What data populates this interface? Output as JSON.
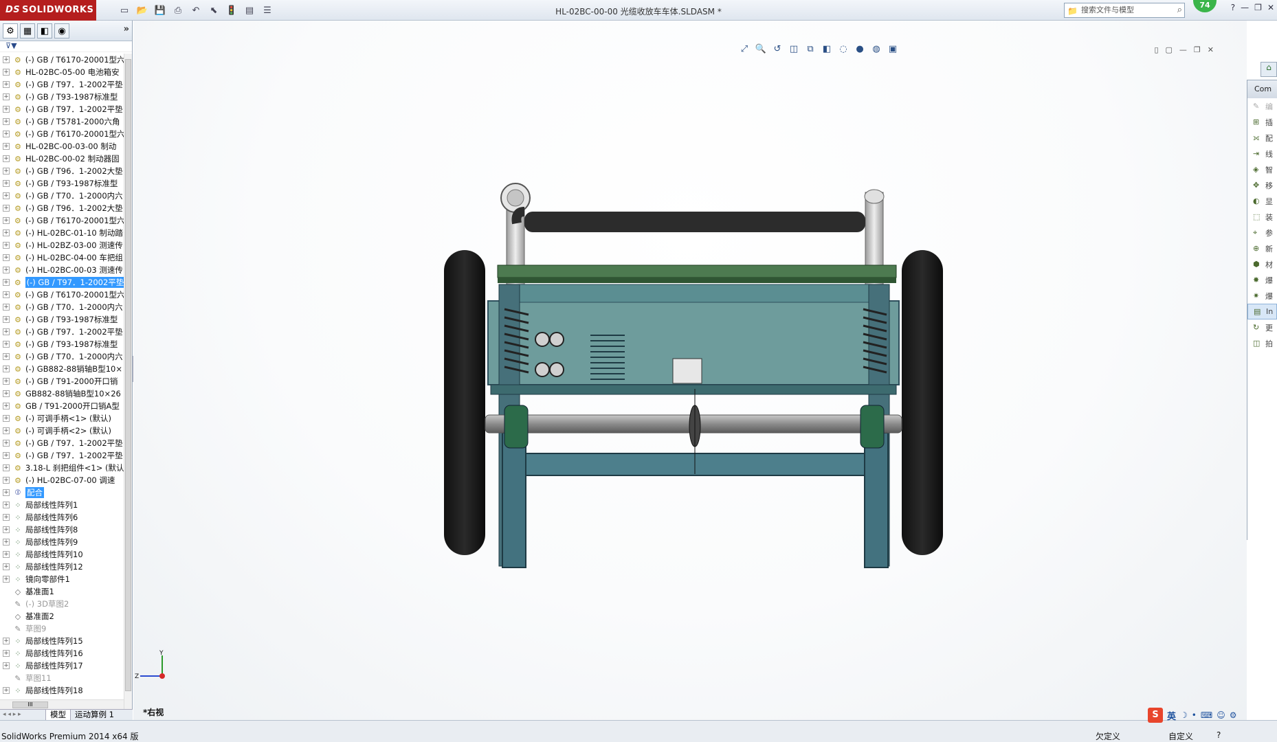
{
  "app": {
    "logo_text": "SOLIDWORKS",
    "logo_mark": "DS",
    "document_title": "HL-02BC-00-00 光缆收放车车体.SLDASM *",
    "search_placeholder": "搜索文件与模型",
    "notification_count": "74"
  },
  "toolbar_icons": [
    "new-icon",
    "open-icon",
    "save-icon",
    "print-icon",
    "undo-icon",
    "select-icon",
    "rebuild-icon",
    "file-props-icon",
    "options-icon"
  ],
  "left_panel": {
    "tabs": [
      "feature-manager",
      "property-manager",
      "config-manager",
      "display-manager"
    ],
    "expand_glyph": "»",
    "filter_glyph": "▼",
    "tree": [
      {
        "label": "(-) GB / T6170-20001型六",
        "icon": "part",
        "expand": true
      },
      {
        "label": "HL-02BC-05-00 电池箱安",
        "icon": "part",
        "expand": true
      },
      {
        "label": "(-) GB / T97．1-2002平垫",
        "icon": "part",
        "expand": true
      },
      {
        "label": "(-) GB / T93-1987标准型",
        "icon": "part",
        "expand": true
      },
      {
        "label": "(-) GB / T97．1-2002平垫",
        "icon": "part",
        "expand": true
      },
      {
        "label": "(-) GB / T5781-2000六角",
        "icon": "part",
        "expand": true
      },
      {
        "label": "(-) GB / T6170-20001型六",
        "icon": "part",
        "expand": true
      },
      {
        "label": "HL-02BC-00-03-00 制动",
        "icon": "part",
        "expand": true
      },
      {
        "label": "HL-02BC-00-02 制动器固",
        "icon": "part",
        "expand": true
      },
      {
        "label": "(-) GB / T96．1-2002大垫",
        "icon": "part",
        "expand": true
      },
      {
        "label": "(-) GB / T93-1987标准型",
        "icon": "part",
        "expand": true
      },
      {
        "label": "(-) GB / T70．1-2000内六",
        "icon": "part",
        "expand": true
      },
      {
        "label": "(-) GB / T96．1-2002大垫",
        "icon": "part",
        "expand": true
      },
      {
        "label": "(-) GB / T6170-20001型六",
        "icon": "part",
        "expand": true
      },
      {
        "label": "(-) HL-02BC-01-10 制动踏",
        "icon": "part",
        "expand": true
      },
      {
        "label": "(-) HL-02BZ-03-00 测速传",
        "icon": "part",
        "expand": true
      },
      {
        "label": "(-) HL-02BC-04-00 车把组",
        "icon": "part",
        "expand": true
      },
      {
        "label": "(-) HL-02BC-00-03 测速传",
        "icon": "part",
        "expand": true
      },
      {
        "label": "(-) GB / T97．1-2002平垫",
        "icon": "part",
        "expand": true,
        "selected": true
      },
      {
        "label": "(-) GB / T6170-20001型六",
        "icon": "part",
        "expand": true
      },
      {
        "label": "(-) GB / T70．1-2000内六",
        "icon": "part",
        "expand": true
      },
      {
        "label": "(-) GB / T93-1987标准型",
        "icon": "part",
        "expand": true
      },
      {
        "label": "(-) GB / T97．1-2002平垫",
        "icon": "part",
        "expand": true
      },
      {
        "label": "(-) GB / T93-1987标准型",
        "icon": "part",
        "expand": true
      },
      {
        "label": "(-) GB / T70．1-2000内六",
        "icon": "part",
        "expand": true
      },
      {
        "label": "(-) GB882-88销轴B型10×",
        "icon": "part",
        "expand": true
      },
      {
        "label": "(-) GB / T91-2000开口销",
        "icon": "part",
        "expand": true
      },
      {
        "label": "GB882-88销轴B型10×26",
        "icon": "part",
        "expand": true
      },
      {
        "label": "GB / T91-2000开口销A型",
        "icon": "part",
        "expand": true
      },
      {
        "label": "(-) 可调手柄<1> (默认)",
        "icon": "part",
        "expand": true
      },
      {
        "label": "(-) 可调手柄<2> (默认)",
        "icon": "part",
        "expand": true
      },
      {
        "label": "(-) GB / T97．1-2002平垫",
        "icon": "part",
        "expand": true
      },
      {
        "label": "(-) GB / T97．1-2002平垫",
        "icon": "part",
        "expand": true
      },
      {
        "label": "3.18-L 刹把组件<1> (默认",
        "icon": "part",
        "expand": true
      },
      {
        "label": "(-) HL-02BC-07-00 调速",
        "icon": "part",
        "expand": true
      },
      {
        "label": "配合",
        "icon": "mate",
        "expand": true,
        "selected": true
      },
      {
        "label": "局部线性阵列1",
        "icon": "pattern",
        "expand": true
      },
      {
        "label": "局部线性阵列6",
        "icon": "pattern",
        "expand": true
      },
      {
        "label": "局部线性阵列8",
        "icon": "pattern",
        "expand": true
      },
      {
        "label": "局部线性阵列9",
        "icon": "pattern",
        "expand": true
      },
      {
        "label": "局部线性阵列10",
        "icon": "pattern",
        "expand": true
      },
      {
        "label": "局部线性阵列12",
        "icon": "pattern",
        "expand": true
      },
      {
        "label": "镜向零部件1",
        "icon": "pattern",
        "expand": true
      },
      {
        "label": "基准面1",
        "icon": "plane",
        "expand": false
      },
      {
        "label": "(-) 3D草图2",
        "icon": "sketch",
        "expand": false,
        "dim": true
      },
      {
        "label": "基准面2",
        "icon": "plane",
        "expand": false
      },
      {
        "label": "草图9",
        "icon": "sketch",
        "expand": false,
        "dim": true
      },
      {
        "label": "局部线性阵列15",
        "icon": "pattern",
        "expand": true
      },
      {
        "label": "局部线性阵列16",
        "icon": "pattern",
        "expand": true
      },
      {
        "label": "局部线性阵列17",
        "icon": "pattern",
        "expand": true
      },
      {
        "label": "草图11",
        "icon": "sketch",
        "expand": false,
        "dim": true
      },
      {
        "label": "局部线性阵列18",
        "icon": "pattern",
        "expand": true
      }
    ],
    "bottom_tabs": [
      "模型",
      "运动算例 1"
    ],
    "hscroll_thumb_text": "III"
  },
  "viewport": {
    "view_label": "*右视",
    "triad": {
      "y_label": "Y",
      "z_label": "Z"
    }
  },
  "task_pane": {
    "header": "Com",
    "items": [
      {
        "label": "编",
        "disabled": true
      },
      {
        "label": "插"
      },
      {
        "label": "配"
      },
      {
        "label": "线"
      },
      {
        "label": "智"
      },
      {
        "label": "移"
      },
      {
        "label": "显"
      },
      {
        "label": "装"
      },
      {
        "label": "参"
      },
      {
        "label": "新"
      },
      {
        "label": "材"
      },
      {
        "label": "爆"
      },
      {
        "label": "爆"
      },
      {
        "label": "In",
        "selected": true
      },
      {
        "label": "更"
      },
      {
        "label": "拍"
      }
    ]
  },
  "status_bar": {
    "left": "SolidWorks Premium 2014 x64 版",
    "under_defined": "欠定义",
    "custom": "自定义",
    "help_glyph": "?"
  },
  "ime": {
    "logo": "S",
    "lang": "英"
  },
  "colors": {
    "frame_teal": "#5f8d8f",
    "frame_edge": "#2d4f5c",
    "rail_green": "#3d6b43",
    "tire": "#1b1b1b",
    "handle_bar": "#2a2a2a",
    "axle": "#8c8c8c",
    "logo_red": "#b51e1e",
    "selection_blue": "#3399ff"
  }
}
